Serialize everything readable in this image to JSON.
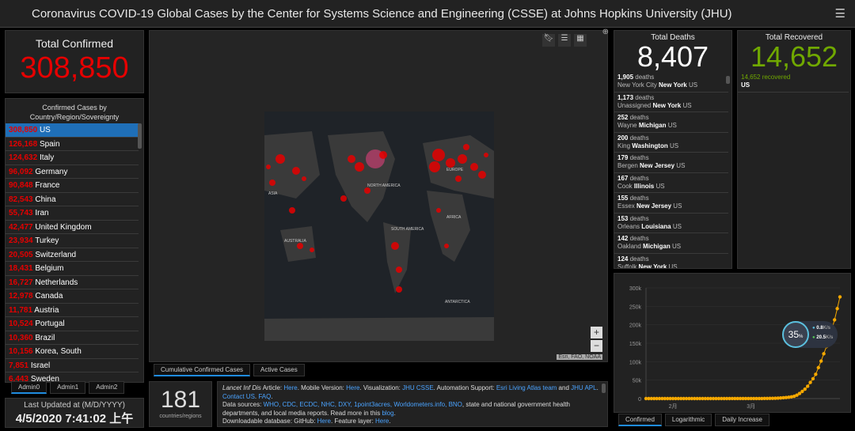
{
  "header": {
    "title": "Coronavirus COVID-19 Global Cases by the Center for Systems Science and Engineering (CSSE) at Johns Hopkins University (JHU)",
    "menu_icon": "hamburger-icon"
  },
  "total_confirmed": {
    "label": "Total Confirmed",
    "value": "308,850"
  },
  "country_list": {
    "header": "Confirmed Cases by Country/Region/Sovereignty",
    "items": [
      {
        "count": "308,850",
        "name": "US"
      },
      {
        "count": "126,168",
        "name": "Spain"
      },
      {
        "count": "124,632",
        "name": "Italy"
      },
      {
        "count": "96,092",
        "name": "Germany"
      },
      {
        "count": "90,848",
        "name": "France"
      },
      {
        "count": "82,543",
        "name": "China"
      },
      {
        "count": "55,743",
        "name": "Iran"
      },
      {
        "count": "42,477",
        "name": "United Kingdom"
      },
      {
        "count": "23,934",
        "name": "Turkey"
      },
      {
        "count": "20,505",
        "name": "Switzerland"
      },
      {
        "count": "18,431",
        "name": "Belgium"
      },
      {
        "count": "16,727",
        "name": "Netherlands"
      },
      {
        "count": "12,978",
        "name": "Canada"
      },
      {
        "count": "11,781",
        "name": "Austria"
      },
      {
        "count": "10,524",
        "name": "Portugal"
      },
      {
        "count": "10,360",
        "name": "Brazil"
      },
      {
        "count": "10,156",
        "name": "Korea, South"
      },
      {
        "count": "7,851",
        "name": "Israel"
      },
      {
        "count": "6,443",
        "name": "Sweden"
      }
    ],
    "tabs": [
      "Admin0",
      "Admin1",
      "Admin2"
    ]
  },
  "last_updated": {
    "label": "Last Updated at (M/D/YYYY)",
    "value": "4/5/2020 7:41:02 上午"
  },
  "map": {
    "labels": [
      "ASIA",
      "NORTH AMERICA",
      "EUROPE",
      "AFRICA",
      "AUSTRALIA",
      "SOUTH AMERICA",
      "ANTARCTICA"
    ],
    "attribution": "Esri, FAO, NOAA",
    "zoom_in": "+",
    "zoom_out": "−",
    "tabs": [
      "Cumulative Confirmed Cases",
      "Active Cases"
    ],
    "marker_color": "#e60000"
  },
  "countries": {
    "value": "181",
    "label": "countries/regions"
  },
  "info": {
    "line1_a": "Lancet Inf Dis",
    "line1_b": " Article: ",
    "here1": "Here",
    "line1_c": ". Mobile Version: ",
    "here2": "Here",
    "line1_d": ". Visualization: ",
    "jhu_csse": "JHU CSSE",
    "line1_e": ". Automation Support: ",
    "esri": "Esri Living Atlas team",
    "and": " and ",
    "jhu_apl": "JHU APL",
    "dot": ". ",
    "contact": "Contact US",
    "dot2": ". ",
    "faq": "FAQ",
    "dot3": ".",
    "ds_label": "Data sources: ",
    "ds_links": "WHO, CDC, ECDC, NHC, DXY, 1point3acres, Worldometers.info, BNO",
    "ds_rest": ", state and national government health departments, and local media reports.  Read more in this ",
    "blog": "blog",
    "dot4": ".",
    "dl_label": "Downloadable database: GitHub: ",
    "here3": "Here",
    "fl": ". Feature layer: ",
    "here4": "Here",
    "dot5": "."
  },
  "deaths": {
    "label": "Total Deaths",
    "value": "8,407",
    "items": [
      {
        "count": "1,905",
        "unit": "deaths",
        "county": "New York City",
        "state": "New York",
        "country": "US"
      },
      {
        "count": "1,173",
        "unit": "deaths",
        "county": "Unassigned",
        "state": "New York",
        "country": "US"
      },
      {
        "count": "252",
        "unit": "deaths",
        "county": "Wayne",
        "state": "Michigan",
        "country": "US"
      },
      {
        "count": "200",
        "unit": "deaths",
        "county": "King",
        "state": "Washington",
        "country": "US"
      },
      {
        "count": "179",
        "unit": "deaths",
        "county": "Bergen",
        "state": "New Jersey",
        "country": "US"
      },
      {
        "count": "167",
        "unit": "deaths",
        "county": "Cook",
        "state": "Illinois",
        "country": "US"
      },
      {
        "count": "155",
        "unit": "deaths",
        "county": "Essex",
        "state": "New Jersey",
        "country": "US"
      },
      {
        "count": "153",
        "unit": "deaths",
        "county": "Orleans",
        "state": "Louisiana",
        "country": "US"
      },
      {
        "count": "142",
        "unit": "deaths",
        "county": "Oakland",
        "state": "Michigan",
        "country": "US"
      },
      {
        "count": "124",
        "unit": "deaths",
        "county": "Suffolk",
        "state": "New York",
        "country": "US"
      }
    ]
  },
  "recovered": {
    "label": "Total Recovered",
    "value": "14,652",
    "items": [
      {
        "count": "14,652 recovered",
        "country": "US"
      }
    ]
  },
  "chart_tabs": [
    "Confirmed",
    "Logarithmic",
    "Daily Increase"
  ],
  "overlay": {
    "percent": "35",
    "unit": "%",
    "up": "0.8",
    "down": "20.5",
    "rate_unit": "K/s"
  },
  "chart_data": {
    "type": "scatter",
    "color": "#f5a800",
    "ylim": [
      0,
      300000
    ],
    "yticks": [
      "0",
      "50k",
      "100k",
      "150k",
      "200k",
      "250k",
      "300k"
    ],
    "xticks": [
      {
        "label": "2月",
        "at": "2/1"
      },
      {
        "label": "3月",
        "at": "3/1"
      }
    ],
    "x": [
      "1/22",
      "1/23",
      "1/24",
      "1/25",
      "1/26",
      "1/27",
      "1/28",
      "1/29",
      "1/30",
      "1/31",
      "2/1",
      "2/2",
      "2/3",
      "2/4",
      "2/5",
      "2/6",
      "2/7",
      "2/8",
      "2/9",
      "2/10",
      "2/11",
      "2/12",
      "2/13",
      "2/14",
      "2/15",
      "2/16",
      "2/17",
      "2/18",
      "2/19",
      "2/20",
      "2/21",
      "2/22",
      "2/23",
      "2/24",
      "2/25",
      "2/26",
      "2/27",
      "2/28",
      "2/29",
      "3/1",
      "3/2",
      "3/3",
      "3/4",
      "3/5",
      "3/6",
      "3/7",
      "3/8",
      "3/9",
      "3/10",
      "3/11",
      "3/12",
      "3/13",
      "3/14",
      "3/15",
      "3/16",
      "3/17",
      "3/18",
      "3/19",
      "3/20",
      "3/21",
      "3/22",
      "3/23",
      "3/24",
      "3/25",
      "3/26",
      "3/27",
      "3/28",
      "3/29",
      "3/30",
      "3/31",
      "4/1",
      "4/2",
      "4/3"
    ],
    "values": [
      1,
      1,
      2,
      2,
      5,
      5,
      5,
      5,
      5,
      6,
      8,
      8,
      11,
      11,
      12,
      12,
      12,
      12,
      12,
      12,
      13,
      13,
      14,
      14,
      14,
      14,
      14,
      14,
      14,
      14,
      15,
      15,
      35,
      35,
      53,
      57,
      60,
      60,
      68,
      75,
      100,
      124,
      158,
      221,
      319,
      435,
      541,
      704,
      994,
      1301,
      1630,
      2183,
      2770,
      3613,
      4596,
      6344,
      9197,
      13779,
      19273,
      25600,
      33276,
      43847,
      53740,
      65778,
      83836,
      101657,
      121465,
      140909,
      161831,
      188172,
      213372,
      243762,
      275586
    ]
  }
}
